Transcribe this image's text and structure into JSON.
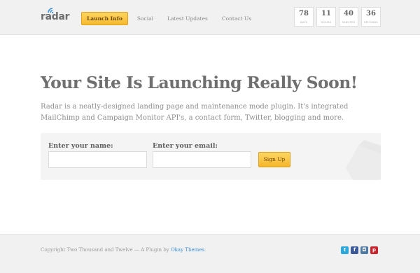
{
  "header": {
    "logo": "radar",
    "nav": [
      {
        "label": "Launch Info",
        "active": true
      },
      {
        "label": "Social",
        "active": false
      },
      {
        "label": "Latest Updates",
        "active": false
      },
      {
        "label": "Contact Us",
        "active": false
      }
    ],
    "countdown": [
      {
        "value": "78",
        "unit": "DAYS"
      },
      {
        "value": "11",
        "unit": "HOURS"
      },
      {
        "value": "40",
        "unit": "MINUTES"
      },
      {
        "value": "36",
        "unit": "SECONDS"
      }
    ]
  },
  "main": {
    "title": "Your Site Is Launching Really Soon!",
    "description": "Radar is a neatly-designed landing page and maintenance mode plugin. It's integrated MailChimp and Campaign Monitor API's, a contact form, Twitter, blogging and more.",
    "signup": {
      "name_label": "Enter your name:",
      "name_value": "",
      "email_label": "Enter your email:",
      "email_value": "",
      "button_label": "Sign Up"
    }
  },
  "footer": {
    "copyright_prefix": "Copyright Two Thousand and Twelve — A Plugin by ",
    "copyright_link": "Okay Themes",
    "copyright_suffix": ".",
    "socials": [
      {
        "icon": "twitter-icon",
        "glyph": "t",
        "color": "#2aa7dd"
      },
      {
        "icon": "facebook-icon",
        "glyph": "f",
        "color": "#3b5998"
      },
      {
        "icon": "instagram-icon",
        "glyph": "◘",
        "color": "#4e7aa3"
      },
      {
        "icon": "pinterest-icon",
        "glyph": "p",
        "color": "#c8232c"
      }
    ]
  },
  "colors": {
    "accent": "#f6b92e",
    "link": "#3b8fd6"
  }
}
